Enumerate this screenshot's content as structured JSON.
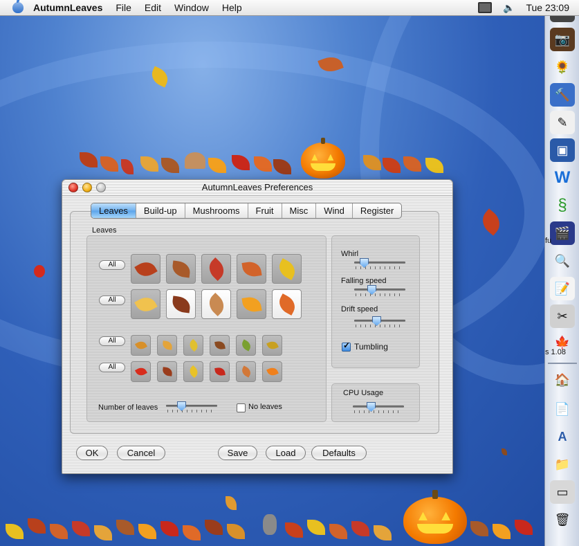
{
  "menubar": {
    "app_name": "AutumnLeaves",
    "menus": [
      "File",
      "Edit",
      "Window",
      "Help"
    ],
    "clock": "Tue 23:09"
  },
  "dock": {
    "labels": {
      "fu": "fu",
      "version": "s 1.08"
    }
  },
  "window": {
    "title": "AutumnLeaves Preferences",
    "tabs": [
      "Leaves",
      "Build-up",
      "Mushrooms",
      "Fruit",
      "Misc",
      "Wind",
      "Register"
    ],
    "active_tab": "Leaves",
    "leaves_group_label": "Leaves",
    "all_label": "All",
    "number_of_leaves_label": "Number of leaves",
    "number_of_leaves_value": 0.25,
    "no_leaves_label": "No leaves",
    "no_leaves_checked": false,
    "motion": {
      "whirl_label": "Whirl",
      "whirl_value": 0.12,
      "falling_label": "Falling speed",
      "falling_value": 0.3,
      "drift_label": "Drift speed",
      "drift_value": 0.42,
      "tumbling_label": "Tumbling",
      "tumbling_checked": true
    },
    "cpu": {
      "label": "CPU Usage",
      "value": 0.32
    },
    "buttons": {
      "ok": "OK",
      "cancel": "Cancel",
      "save": "Save",
      "load": "Load",
      "defaults": "Defaults"
    }
  },
  "leaf_rows": {
    "row1": {
      "tiles": [
        {
          "color": "#b8401c",
          "on": false
        },
        {
          "color": "#a85a2a",
          "on": false
        },
        {
          "color": "#c63a28",
          "on": false
        },
        {
          "color": "#d2632a",
          "on": false
        },
        {
          "color": "#e8c020",
          "on": false
        }
      ]
    },
    "row2": {
      "tiles": [
        {
          "color": "#f0c24e",
          "on": false
        },
        {
          "color": "#8a3a1c",
          "on": true
        },
        {
          "color": "#c98a52",
          "on": true
        },
        {
          "color": "#f2a020",
          "on": false
        },
        {
          "color": "#e06a28",
          "on": true
        }
      ]
    },
    "row3": {
      "tiles": [
        {
          "color": "#d8902a",
          "on": false
        },
        {
          "color": "#e4a43a",
          "on": false
        },
        {
          "color": "#e0c030",
          "on": false
        },
        {
          "color": "#8a4a20",
          "on": false
        },
        {
          "color": "#7aa030",
          "on": false
        },
        {
          "color": "#c8a020",
          "on": false
        }
      ]
    },
    "row4": {
      "tiles": [
        {
          "color": "#d82c1c",
          "on": false
        },
        {
          "color": "#9a3c1c",
          "on": false
        },
        {
          "color": "#e8c228",
          "on": false
        },
        {
          "color": "#c8281c",
          "on": false
        },
        {
          "color": "#d27838",
          "on": false
        },
        {
          "color": "#f0801c",
          "on": false
        }
      ]
    }
  },
  "colors": {
    "desktop": "#2f5fb8",
    "accent": "#5aa3ea",
    "pumpkin": "#f47a00"
  }
}
